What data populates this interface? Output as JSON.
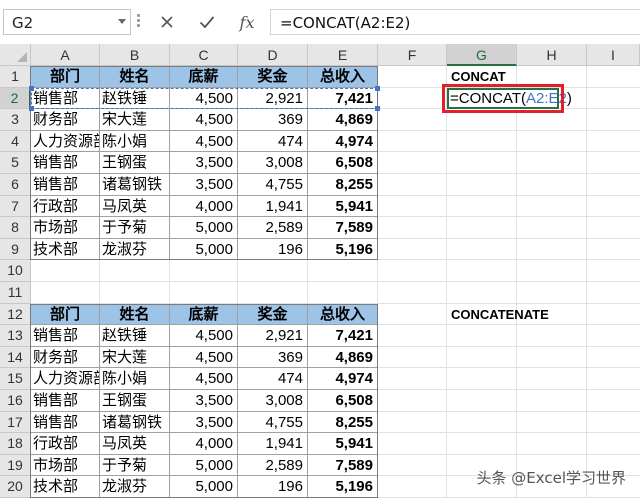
{
  "formula_bar": {
    "name_box": "G2",
    "cancel_icon": "✕",
    "enter_icon": "✓",
    "fx_label": "fx",
    "formula": "=CONCAT(A2:E2)"
  },
  "columns": [
    "A",
    "B",
    "C",
    "D",
    "E",
    "F",
    "G",
    "H",
    "I"
  ],
  "rows": [
    "1",
    "2",
    "3",
    "4",
    "5",
    "6",
    "7",
    "8",
    "9",
    "10",
    "11",
    "12",
    "13",
    "14",
    "15",
    "16",
    "17",
    "18",
    "19",
    "20"
  ],
  "table_headers": [
    "部门",
    "姓名",
    "底薪",
    "奖金",
    "总收入"
  ],
  "table1": [
    [
      "销售部",
      "赵铁锤",
      "4,500",
      "2,921",
      "7,421"
    ],
    [
      "财务部",
      "宋大莲",
      "4,500",
      "369",
      "4,869"
    ],
    [
      "人力资源部",
      "陈小娟",
      "4,500",
      "474",
      "4,974"
    ],
    [
      "销售部",
      "王钢蛋",
      "3,500",
      "3,008",
      "6,508"
    ],
    [
      "销售部",
      "诸葛钢铁",
      "3,500",
      "4,755",
      "8,255"
    ],
    [
      "行政部",
      "马凤英",
      "4,000",
      "1,941",
      "5,941"
    ],
    [
      "市场部",
      "于予菊",
      "5,000",
      "2,589",
      "7,589"
    ],
    [
      "技术部",
      "龙淑芬",
      "5,000",
      "196",
      "5,196"
    ]
  ],
  "table2": [
    [
      "销售部",
      "赵铁锤",
      "4,500",
      "2,921",
      "7,421"
    ],
    [
      "财务部",
      "宋大莲",
      "4,500",
      "369",
      "4,869"
    ],
    [
      "人力资源部",
      "陈小娟",
      "4,500",
      "474",
      "4,974"
    ],
    [
      "销售部",
      "王钢蛋",
      "3,500",
      "3,008",
      "6,508"
    ],
    [
      "销售部",
      "诸葛钢铁",
      "3,500",
      "4,755",
      "8,255"
    ],
    [
      "行政部",
      "马凤英",
      "4,000",
      "1,941",
      "5,941"
    ],
    [
      "市场部",
      "于予菊",
      "5,000",
      "2,589",
      "7,589"
    ],
    [
      "技术部",
      "龙淑芬",
      "5,000",
      "196",
      "5,196"
    ]
  ],
  "labels": {
    "concat": "CONCAT",
    "concatenate": "CONCATENATE"
  },
  "edit_cell": {
    "prefix": "=CONCAT(",
    "ref": "A2:E2",
    "suffix": ")"
  },
  "watermark": "头条 @Excel学习世界",
  "colors": {
    "header_fill": "#9dc3e6",
    "excel_green": "#217346",
    "highlight_red": "#e3202a",
    "reference_blue": "#4472c4"
  }
}
